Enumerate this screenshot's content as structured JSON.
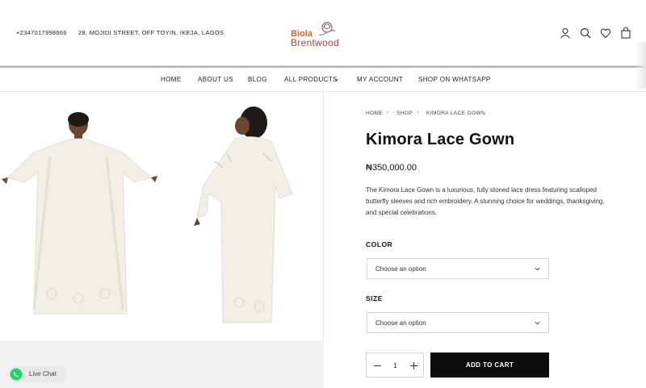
{
  "header": {
    "phone": "+2347017998666",
    "address": "28, MOJIDI STREET, OFF TOYIN, IKEJA, LAGOS",
    "logo": {
      "line1": "Biola",
      "line2": "Brentwood"
    },
    "icons": [
      "user-icon",
      "search-icon",
      "heart-icon",
      "cart-icon"
    ]
  },
  "nav": {
    "items": [
      {
        "label": "HOME"
      },
      {
        "label": "ABOUT US"
      },
      {
        "label": "BLOG"
      },
      {
        "label": "ALL PRODUCTS"
      },
      {
        "label": "MY ACCOUNT"
      },
      {
        "label": "SHOP ON WHATSAPP"
      }
    ]
  },
  "breadcrumb": [
    "HOME",
    "SHOP",
    "KIMORA LACE GOWN"
  ],
  "product": {
    "title": "Kimora Lace Gown",
    "price": "₦350,000.00",
    "description": "The Kimora Lace Gown is a luxurious, fully stoned lace dress featuring scalloped butterfly sleeves and rich embroidery. A stunning choice for weddings, thanksgiving, and special celebrations.",
    "color": {
      "label": "COLOR",
      "placeholder": "Choose an option"
    },
    "size": {
      "label": "SIZE",
      "placeholder": "Choose an option"
    },
    "quantity": "1",
    "add_to_cart": "ADD TO CART"
  },
  "live_chat": {
    "label": "Live Chat"
  },
  "colors": {
    "brand_orange": "#e2622b",
    "brand_maroon": "#a0443f",
    "button_black": "#0d0d0d"
  }
}
